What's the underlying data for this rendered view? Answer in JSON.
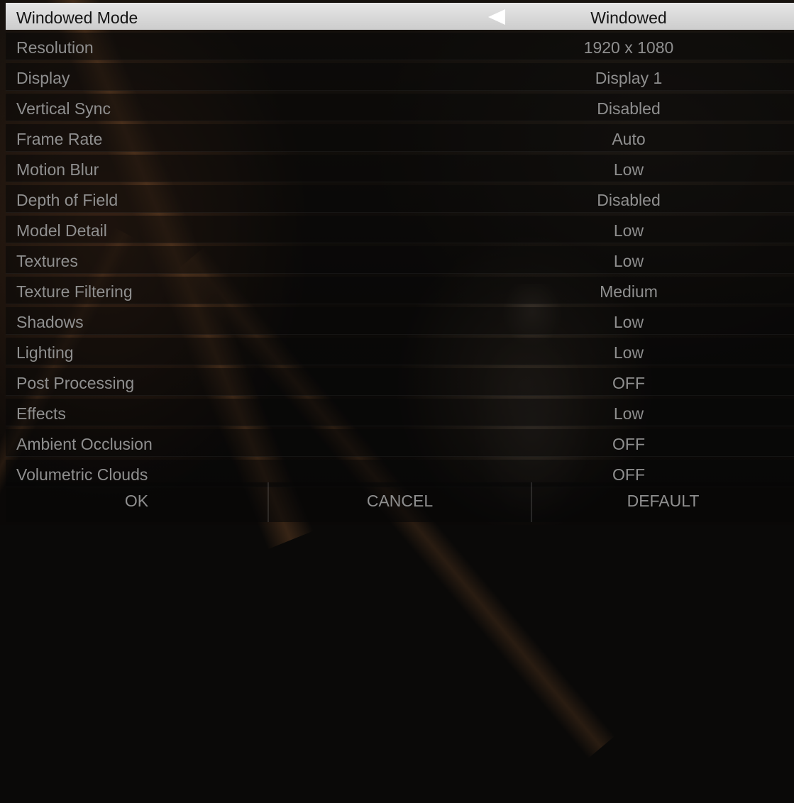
{
  "settings": [
    {
      "label": "Windowed Mode",
      "value": "Windowed"
    },
    {
      "label": "Resolution",
      "value": "1920 x 1080"
    },
    {
      "label": "Display",
      "value": "Display 1"
    },
    {
      "label": "Vertical Sync",
      "value": "Disabled"
    },
    {
      "label": "Frame Rate",
      "value": "Auto"
    },
    {
      "label": "Motion Blur",
      "value": "Low"
    },
    {
      "label": "Depth of Field",
      "value": "Disabled"
    },
    {
      "label": "Model Detail",
      "value": "Low"
    },
    {
      "label": "Textures",
      "value": "Low"
    },
    {
      "label": "Texture Filtering",
      "value": "Medium"
    },
    {
      "label": "Shadows",
      "value": "Low"
    },
    {
      "label": "Lighting",
      "value": "Low"
    },
    {
      "label": "Post Processing",
      "value": "OFF"
    },
    {
      "label": "Effects",
      "value": "Low"
    },
    {
      "label": "Ambient Occlusion",
      "value": "OFF"
    },
    {
      "label": "Volumetric Clouds",
      "value": "OFF"
    }
  ],
  "buttons": {
    "ok": "OK",
    "cancel": "CANCEL",
    "default": "DEFAULT"
  },
  "icons": {
    "selected_row_arrow": "arrow-left-icon"
  },
  "colors": {
    "selected_row_bg": "#d8d8d8",
    "selected_row_text": "#141414",
    "row_text": "#8f8f8f",
    "arrow": "#ffffff"
  }
}
